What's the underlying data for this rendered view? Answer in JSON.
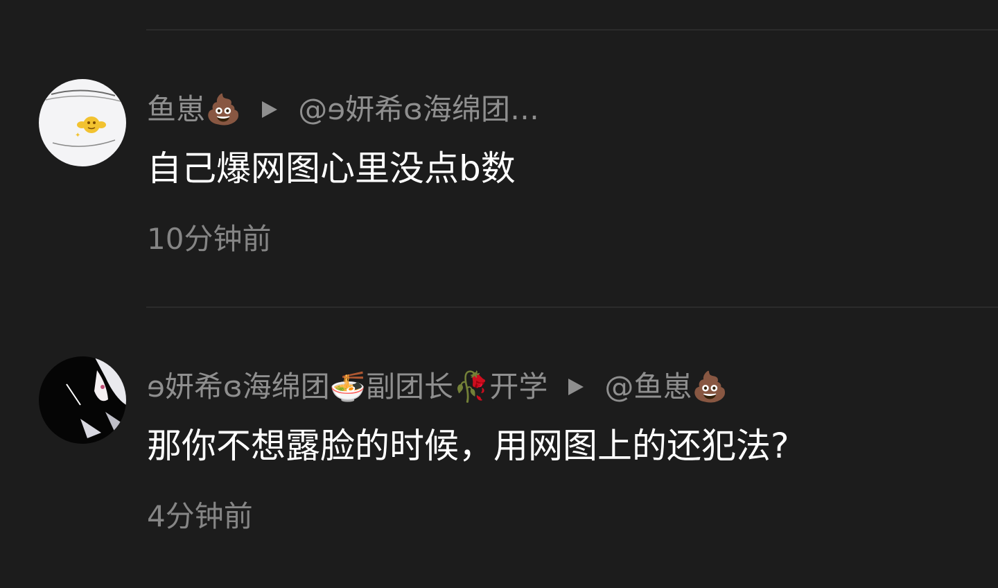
{
  "comments": [
    {
      "author": "鱼崽💩",
      "reply_to": "@ɘ妍希ɞ海绵团…",
      "text": "自己爆网图心里没点b数",
      "time": "10分钟前"
    },
    {
      "author": "ɘ妍希ɞ海绵团🍜副团长🥀开学",
      "reply_to": "@鱼崽💩",
      "text": "那你不想露脸的时候，用网图上的还犯法?",
      "time": "4分钟前"
    }
  ],
  "icons": {
    "reply_arrow": "triangle-right-icon",
    "avatar_1": "avatar-image",
    "avatar_2": "avatar-image"
  },
  "colors": {
    "background": "#1c1c1c",
    "divider": "#2b2b2b",
    "meta_text": "#8f8f8f",
    "content_text": "#ffffff"
  }
}
